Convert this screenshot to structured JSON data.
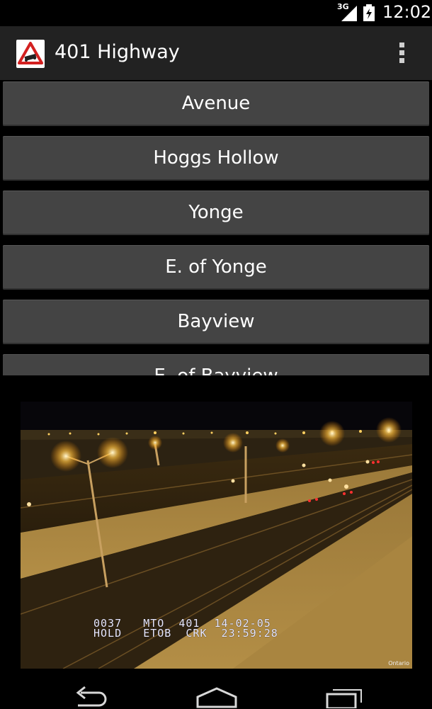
{
  "status_bar": {
    "network_type": "3G",
    "time": "12:02",
    "icons": [
      "signal-icon",
      "battery-icon"
    ]
  },
  "action_bar": {
    "app_icon": "hazard-sign-icon",
    "title": "401 Highway",
    "overflow_icon": "overflow-menu-icon"
  },
  "camera_list": {
    "items": [
      {
        "label": "Avenue"
      },
      {
        "label": "Hoggs Hollow"
      },
      {
        "label": "Yonge"
      },
      {
        "label": "E. of Yonge"
      },
      {
        "label": "Bayview"
      },
      {
        "label": "E. of Bayview"
      }
    ]
  },
  "camera_feed": {
    "line1": "0037   MTO  401  14-02-05",
    "line2": "HOLD   ETOB  CRK  23:59:28",
    "logo": "Ontario"
  },
  "nav_bar": {
    "icons": [
      "back-icon",
      "home-icon",
      "recent-apps-icon"
    ]
  }
}
